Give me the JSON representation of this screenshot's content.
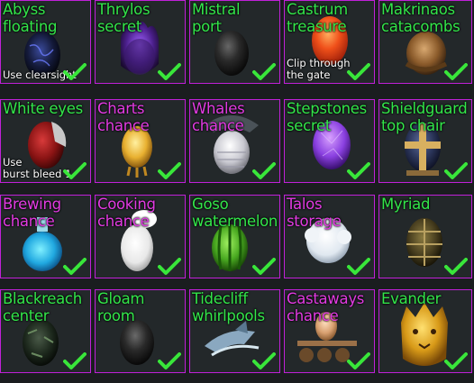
{
  "cells": [
    {
      "title": "Abyss\nfloating",
      "color": "green",
      "note": "Use clearsight",
      "item": "dark-blue-egg-icon",
      "checked": true
    },
    {
      "title": "Thrylos\nsecret",
      "color": "green",
      "note": "",
      "item": "purple-flame-egg-icon",
      "checked": true
    },
    {
      "title": "Mistral\nport",
      "color": "green",
      "note": "",
      "item": "black-egg-icon",
      "checked": true
    },
    {
      "title": "Castrum\ntreasure",
      "color": "green",
      "note": "Clip through\nthe gate",
      "item": "orange-red-egg-icon",
      "checked": true
    },
    {
      "title": "Makrinaos\ncatacombs",
      "color": "green",
      "note": "",
      "item": "brown-sack-egg-icon",
      "checked": true
    },
    {
      "title": "White eyes",
      "color": "green",
      "note": "Use\nburst bleed 1",
      "item": "red-beast-egg-icon",
      "checked": true
    },
    {
      "title": "Charts\nchance",
      "color": "pink",
      "note": "",
      "item": "golden-chick-egg-icon",
      "checked": true
    },
    {
      "title": "Whales\nchance",
      "color": "pink",
      "note": "",
      "item": "whale-egg-icon",
      "checked": true
    },
    {
      "title": "Stepstones\nsecret",
      "color": "green",
      "note": "",
      "item": "violet-crystal-egg-icon",
      "checked": true
    },
    {
      "title": "Shieldguard\ntop chair",
      "color": "green",
      "note": "",
      "item": "shield-cross-egg-icon",
      "checked": true
    },
    {
      "title": "Brewing\nchance",
      "color": "pink",
      "note": "",
      "item": "blue-potion-egg-icon",
      "checked": true
    },
    {
      "title": "Cooking\nchance",
      "color": "pink",
      "note": "",
      "item": "chef-egg-icon",
      "checked": true
    },
    {
      "title": "Goso\nwatermelon",
      "color": "green",
      "note": "",
      "item": "watermelon-egg-icon",
      "checked": true
    },
    {
      "title": "Talos\nstorage",
      "color": "pink",
      "note": "",
      "item": "white-fluffy-egg-icon",
      "checked": true
    },
    {
      "title": "Myriad",
      "color": "green",
      "note": "",
      "item": "bronze-armored-egg-icon",
      "checked": true
    },
    {
      "title": "Blackreach\ncenter",
      "color": "green",
      "note": "",
      "item": "dark-mossy-egg-icon",
      "checked": true
    },
    {
      "title": "Gloam\nroom",
      "color": "green",
      "note": "",
      "item": "black-stone-egg-icon",
      "checked": true
    },
    {
      "title": "Tidecliff\nwhirlpools",
      "color": "green",
      "note": "",
      "item": "fish-fin-egg-icon",
      "checked": true
    },
    {
      "title": "Castaways\nchance",
      "color": "pink",
      "note": "",
      "item": "raft-egg-icon",
      "checked": true
    },
    {
      "title": "Evander",
      "color": "green",
      "note": "",
      "item": "golden-lion-egg-icon",
      "checked": true
    }
  ],
  "colors": {
    "border": "#c020d8",
    "green": "#33e64a",
    "pink": "#e23be2",
    "check": "#39e63a"
  }
}
